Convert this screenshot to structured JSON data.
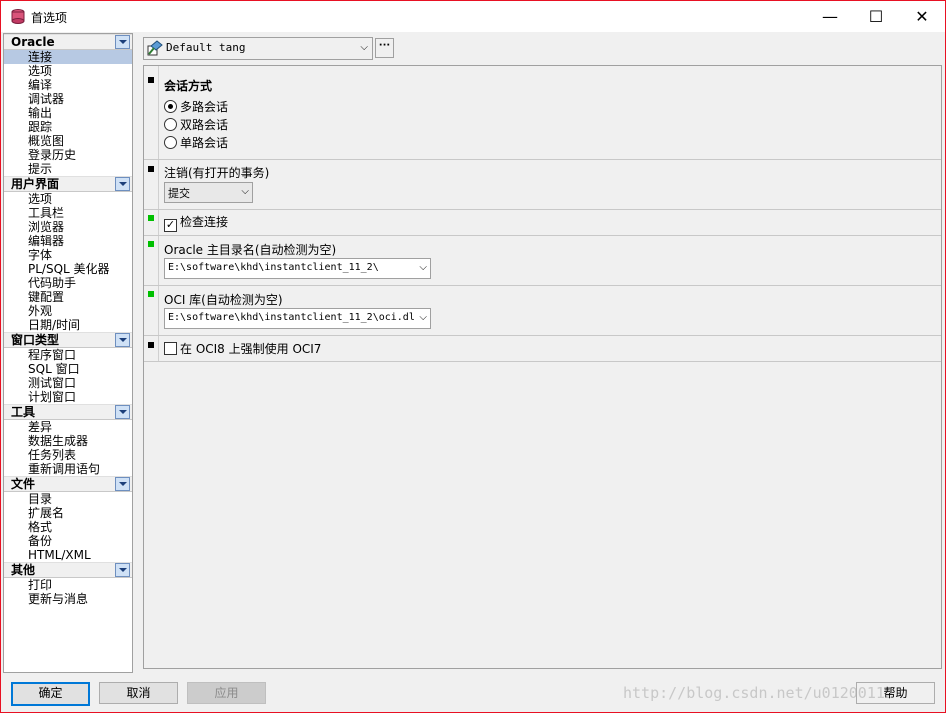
{
  "window": {
    "title": "首选项",
    "min_glyph": "—",
    "max_glyph": "☐",
    "close_glyph": "✕"
  },
  "nav": {
    "groups": [
      {
        "header": "Oracle",
        "items": [
          "连接",
          "选项",
          "编译",
          "调试器",
          "输出",
          "跟踪",
          "概览图",
          "登录历史",
          "提示"
        ]
      },
      {
        "header": "用户界面",
        "items": [
          "选项",
          "工具栏",
          "浏览器",
          "编辑器",
          "字体",
          "PL/SQL 美化器",
          "代码助手",
          "键配置",
          "外观",
          "日期/时间"
        ]
      },
      {
        "header": "窗口类型",
        "items": [
          "程序窗口",
          "SQL 窗口",
          "测试窗口",
          "计划窗口"
        ]
      },
      {
        "header": "工具",
        "items": [
          "差异",
          "数据生成器",
          "任务列表",
          "重新调用语句"
        ]
      },
      {
        "header": "文件",
        "items": [
          "目录",
          "扩展名",
          "格式",
          "备份",
          "HTML/XML"
        ]
      },
      {
        "header": "其他",
        "items": [
          "打印",
          "更新与消息"
        ]
      }
    ]
  },
  "profile": {
    "value": "Default tang",
    "ellipsis": "···"
  },
  "sections": {
    "session_mode": {
      "label": "会话方式",
      "options": [
        "多路会话",
        "双路会话",
        "单路会话"
      ],
      "selected_index": 0
    },
    "logoff": {
      "label": "注销(有打开的事务)",
      "value": "提交"
    },
    "check_connection": {
      "label": "检查连接",
      "checked": true,
      "check_glyph": "✓"
    },
    "oracle_home": {
      "label": "Oracle 主目录名(自动检测为空)",
      "value": "E:\\software\\khd\\instantclient_11_2\\"
    },
    "oci_library": {
      "label": "OCI 库(自动检测为空)",
      "value": "E:\\software\\khd\\instantclient_11_2\\oci.dl"
    },
    "force_oci7": {
      "label": "在 OCI8 上强制使用 OCI7",
      "checked": false
    }
  },
  "buttons": {
    "ok": "确定",
    "cancel": "取消",
    "apply": "应用",
    "help": "帮助"
  },
  "watermark": "http://blog.csdn.net/u01200112",
  "colors": {
    "selection": "#b7c9e3",
    "accent": "#0078d7",
    "marker_green": "#00c000"
  }
}
